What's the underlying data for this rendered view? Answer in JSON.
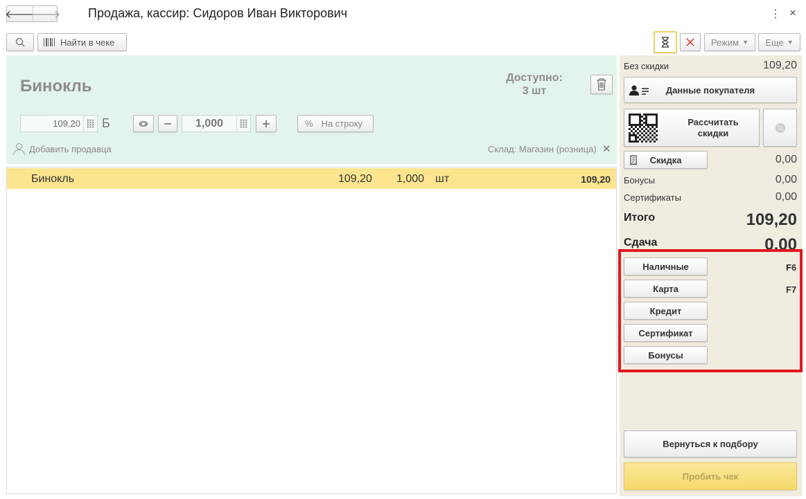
{
  "header": {
    "title": "Продажа, кассир: Сидоров Иван Викторович",
    "back_glyph": "🡐",
    "forward_glyph": "🡒",
    "kebab_glyph": "⋮",
    "close_glyph": "×"
  },
  "toolbar": {
    "find_label": "Найти в чеке",
    "mode_label": "Режим",
    "more_label": "Еще"
  },
  "product": {
    "name": "Бинокль",
    "available_label": "Доступно:",
    "available_value": "3 шт",
    "price": "109,20",
    "currency_symbol": "Б",
    "quantity": "1,000",
    "per_row_label": "На строку",
    "per_row_symbol": "%",
    "add_seller_label": "Добавить продавца",
    "warehouse_label": "Склад: Магазин (розница)"
  },
  "receipt_rows": [
    {
      "name": "Бинокль",
      "price": "109,20",
      "quantity": "1,000",
      "unit": "шт",
      "sum": "109,20"
    }
  ],
  "summary": {
    "no_discount_label": "Без скидки",
    "no_discount_value": "109,20",
    "customer_button": "Данные покупателя",
    "calc_discounts_button": "Рассчитать скидки",
    "discount_button": "Скидка",
    "discount_value": "0,00",
    "bonuses_label": "Бонусы",
    "bonuses_value": "0,00",
    "certificates_label": "Сертификаты",
    "certificates_value": "0,00",
    "total_label": "Итого",
    "total_value": "109,20",
    "change_label": "Сдача",
    "change_value": "0,00"
  },
  "payment": {
    "methods": [
      {
        "label": "Наличные",
        "hotkey": "F6"
      },
      {
        "label": "Карта",
        "hotkey": "F7"
      },
      {
        "label": "Кредит",
        "hotkey": ""
      },
      {
        "label": "Сертификат",
        "hotkey": ""
      },
      {
        "label": "Бонусы",
        "hotkey": ""
      }
    ],
    "highlight_color": "#e0181f"
  },
  "actions": {
    "return_button": "Вернуться к подбору",
    "punch_button": "Пробить чек"
  },
  "colors": {
    "product_panel": "#e3f4ec",
    "selected_row": "#fde58f",
    "right_panel": "#f1ece0",
    "punch_button": "#f5d96a"
  }
}
